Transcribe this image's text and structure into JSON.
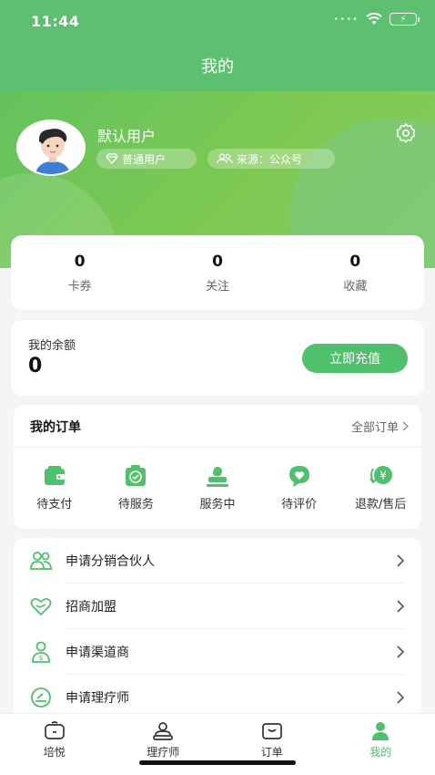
{
  "status_bar": {
    "time": "11:44"
  },
  "nav": {
    "title": "我的"
  },
  "colors": {
    "primary": "#4fc06c",
    "header_green": "#5cc070"
  },
  "profile": {
    "name": "默认用户",
    "level_badge": "普通用户",
    "source_badge": "来源：公众号",
    "avatar_icon": "avatar-illustration",
    "settings_icon": "gear-icon"
  },
  "stats": [
    {
      "value": "0",
      "label": "卡券"
    },
    {
      "value": "0",
      "label": "关注"
    },
    {
      "value": "0",
      "label": "收藏"
    }
  ],
  "balance": {
    "label": "我的余额",
    "value": "0",
    "recharge_label": "立即充值"
  },
  "orders": {
    "title": "我的订单",
    "all_label": "全部订单",
    "items": [
      {
        "label": "待支付",
        "icon": "wallet-icon"
      },
      {
        "label": "待服务",
        "icon": "calendar-check-icon"
      },
      {
        "label": "服务中",
        "icon": "service-stamp-icon"
      },
      {
        "label": "待评价",
        "icon": "heart-chat-icon"
      },
      {
        "label": "退款/售后",
        "icon": "refund-yen-icon"
      }
    ]
  },
  "menu": [
    {
      "label": "申请分销合伙人",
      "icon": "partners-icon"
    },
    {
      "label": "招商加盟",
      "icon": "handshake-heart-icon"
    },
    {
      "label": "申请渠道商",
      "icon": "channel-person-icon"
    },
    {
      "label": "申请理疗师",
      "icon": "therapist-icon"
    }
  ],
  "tabs": [
    {
      "label": "培悦",
      "icon": "home-icon",
      "active": false
    },
    {
      "label": "理疗师",
      "icon": "therapist-tab-icon",
      "active": false
    },
    {
      "label": "订单",
      "icon": "order-tab-icon",
      "active": false
    },
    {
      "label": "我的",
      "icon": "profile-tab-icon",
      "active": true
    }
  ]
}
